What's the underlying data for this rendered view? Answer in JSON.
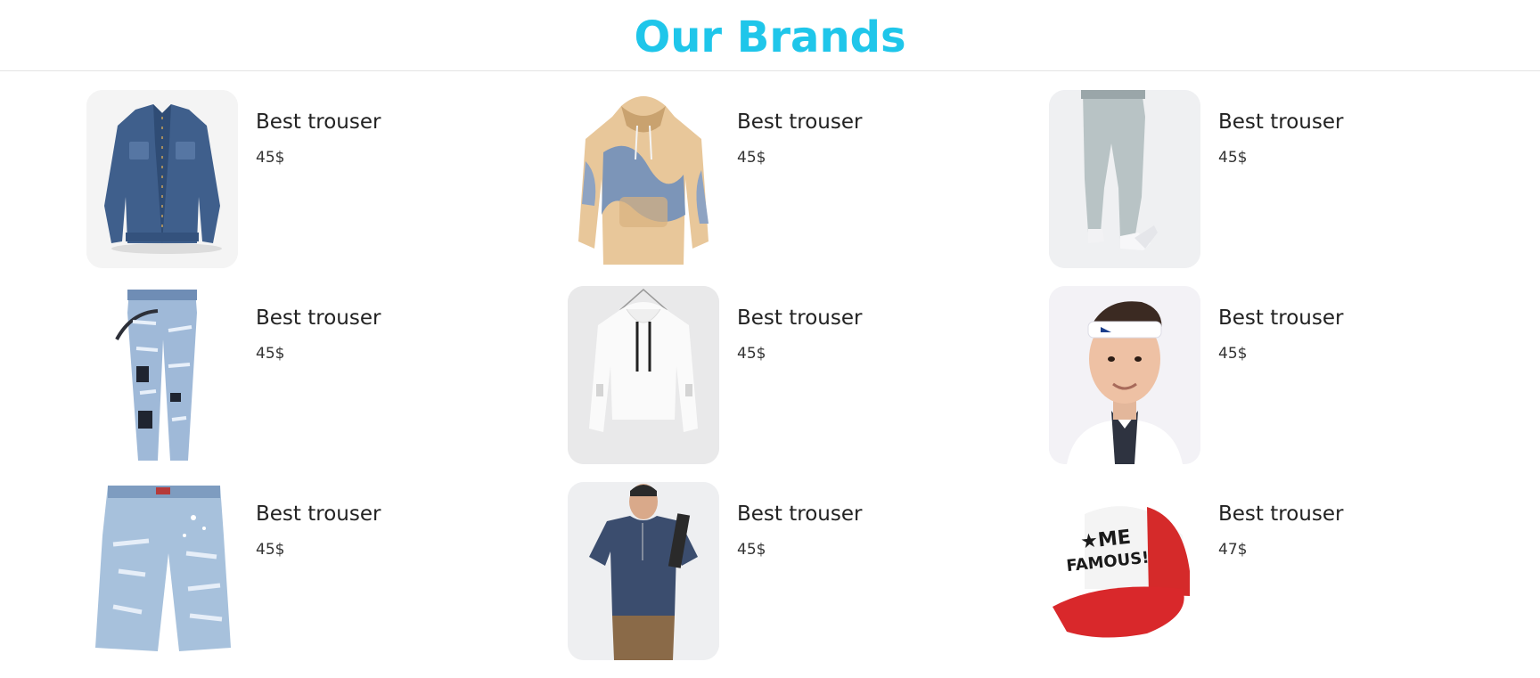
{
  "header": {
    "title": "Our Brands"
  },
  "products": [
    {
      "name": "Best trouser",
      "price": "45$",
      "image": "denim-jacket-image"
    },
    {
      "name": "Best trouser",
      "price": "45$",
      "image": "tie-dye-hoodie-image"
    },
    {
      "name": "Best trouser",
      "price": "45$",
      "image": "grey-joggers-image"
    },
    {
      "name": "Best trouser",
      "price": "45$",
      "image": "ripped-jeans-image"
    },
    {
      "name": "Best trouser",
      "price": "45$",
      "image": "white-cropped-hoodie-image"
    },
    {
      "name": "Best trouser",
      "price": "45$",
      "image": "man-headband-image"
    },
    {
      "name": "Best trouser",
      "price": "45$",
      "image": "denim-shorts-image"
    },
    {
      "name": "Best trouser",
      "price": "45$",
      "image": "navy-tshirt-image"
    },
    {
      "name": "Best trouser",
      "price": "47$",
      "image": "trucker-cap-image"
    }
  ],
  "colors": {
    "title": "#1fc6ea",
    "divider": "#e4e4e4"
  }
}
